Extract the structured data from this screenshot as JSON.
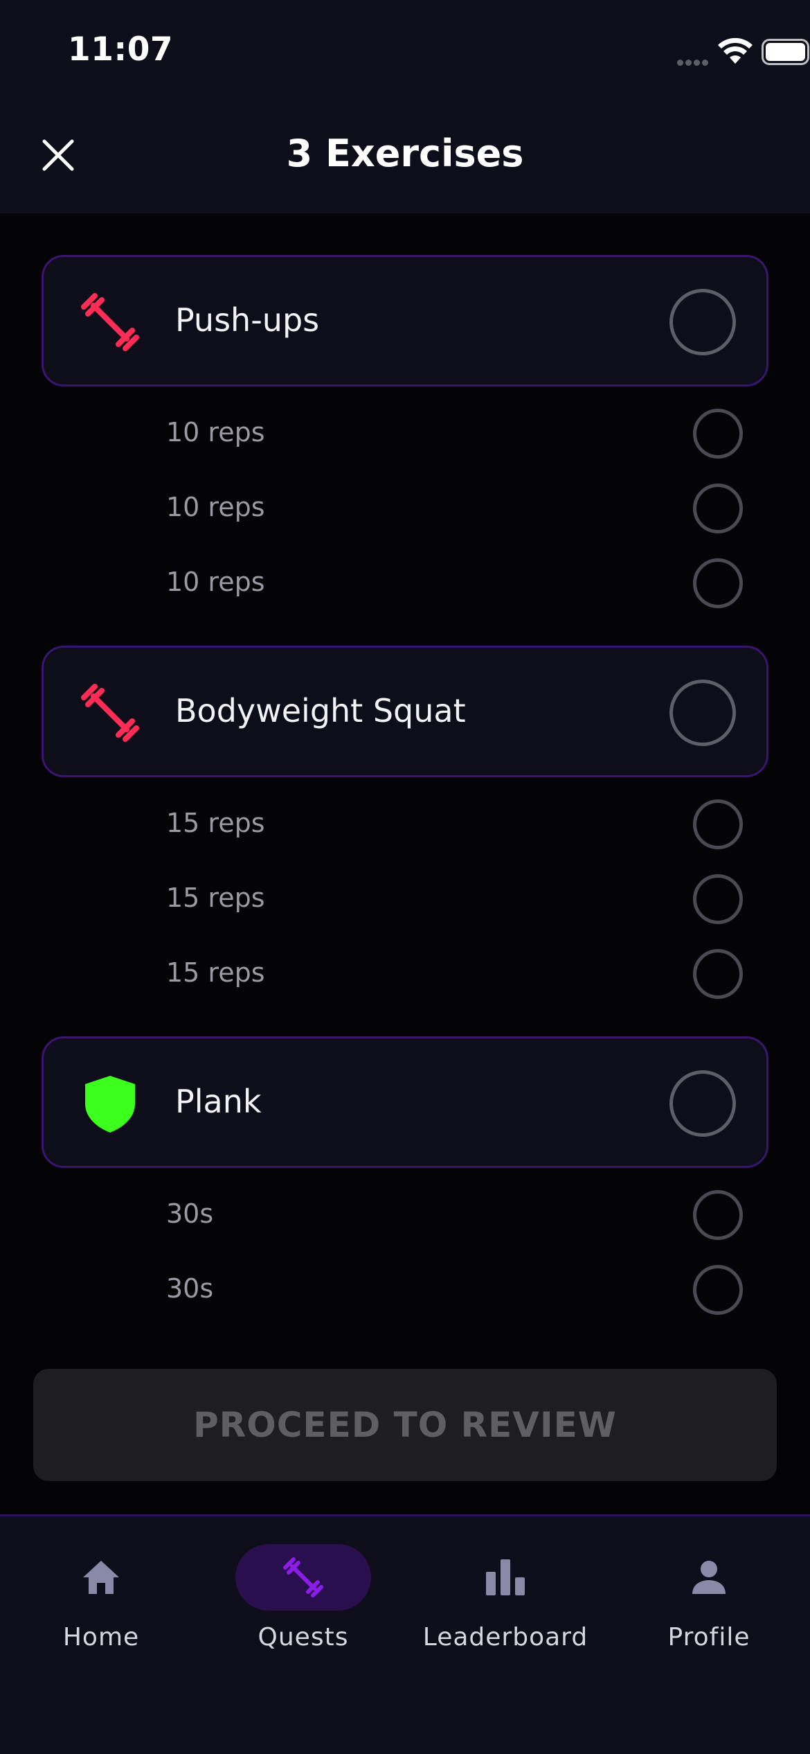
{
  "status_bar": {
    "time": "11:07"
  },
  "header": {
    "title": "3 Exercises"
  },
  "exercises": [
    {
      "name": "Push-ups",
      "icon": "dumbbell-icon",
      "icon_color": "#ff2d55",
      "sets": [
        "10 reps",
        "10 reps",
        "10 reps"
      ]
    },
    {
      "name": "Bodyweight Squat",
      "icon": "dumbbell-icon",
      "icon_color": "#ff2d55",
      "sets": [
        "15 reps",
        "15 reps",
        "15 reps"
      ]
    },
    {
      "name": "Plank",
      "icon": "shield-icon",
      "icon_color": "#3cff1e",
      "sets": [
        "30s",
        "30s"
      ]
    }
  ],
  "proceed_button": {
    "label": "PROCEED TO REVIEW"
  },
  "bottom_nav": {
    "items": [
      {
        "label": "Home",
        "icon": "home-icon",
        "active": false
      },
      {
        "label": "Quests",
        "icon": "dumbbell-icon",
        "active": true
      },
      {
        "label": "Leaderboard",
        "icon": "bar-chart-icon",
        "active": false
      },
      {
        "label": "Profile",
        "icon": "person-icon",
        "active": false
      }
    ]
  },
  "colors": {
    "accent": "#8a1ee6",
    "card_border": "#3a1570",
    "background": "#040406",
    "surface": "#0d0e1a"
  }
}
